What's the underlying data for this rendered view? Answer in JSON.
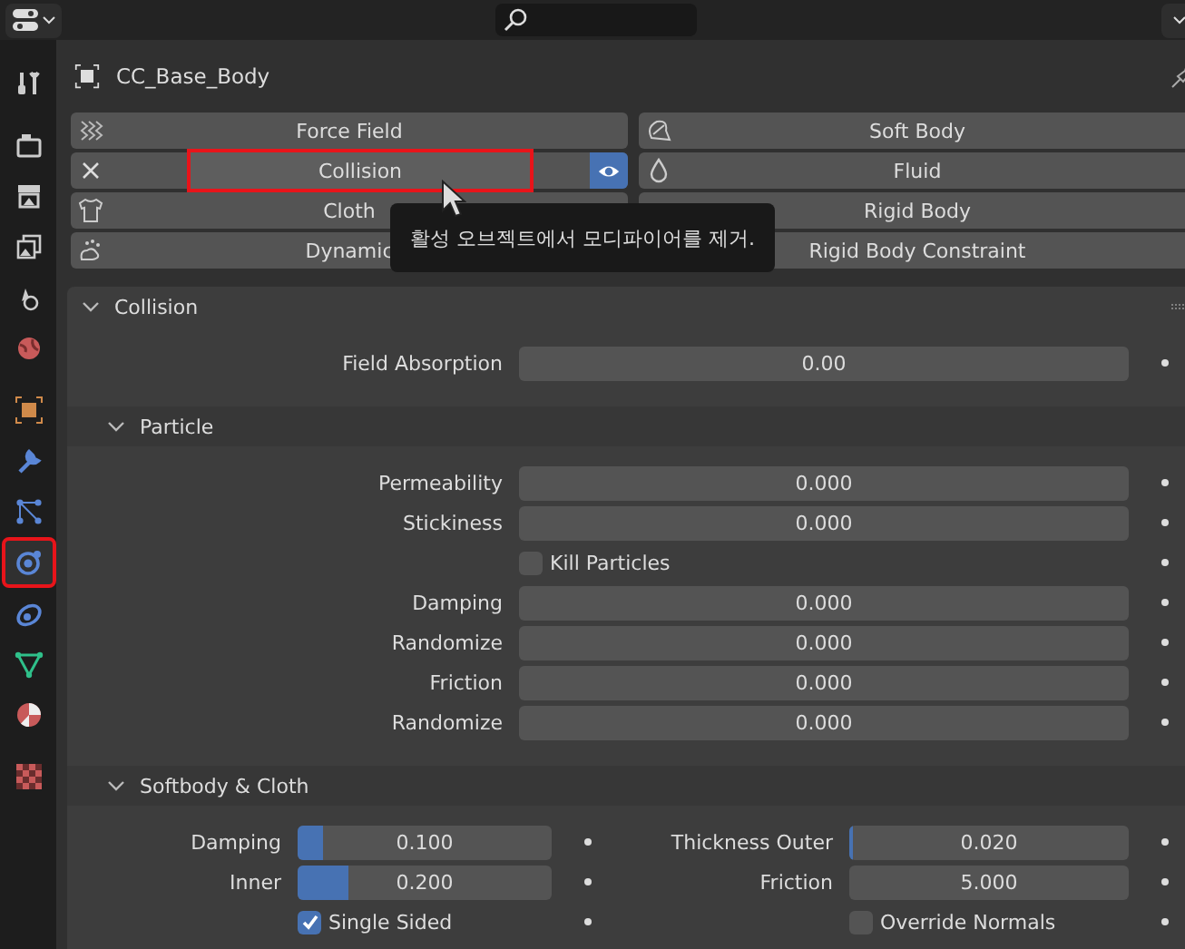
{
  "sidebar": [
    [
      {
        "kind": "tool",
        "selected": false,
        "highlighted": false
      }
    ],
    [
      {
        "kind": "render",
        "selected": false,
        "highlighted": false
      },
      {
        "kind": "output",
        "selected": false,
        "highlighted": false
      },
      {
        "kind": "view_layer",
        "selected": false,
        "highlighted": false
      },
      {
        "kind": "scene",
        "selected": false,
        "highlighted": false
      },
      {
        "kind": "world",
        "selected": false,
        "highlighted": false
      }
    ],
    [
      {
        "kind": "object",
        "selected": false,
        "highlighted": false
      },
      {
        "kind": "modifiers",
        "selected": false,
        "highlighted": false
      },
      {
        "kind": "particles",
        "selected": false,
        "highlighted": false
      },
      {
        "kind": "physics",
        "selected": true,
        "highlighted": true
      },
      {
        "kind": "constraints",
        "selected": false,
        "highlighted": false
      },
      {
        "kind": "data",
        "selected": false,
        "highlighted": false
      },
      {
        "kind": "material",
        "selected": false,
        "highlighted": false
      }
    ],
    [
      {
        "kind": "texture",
        "selected": false,
        "highlighted": false
      }
    ]
  ],
  "header": {
    "object_name": "CC_Base_Body"
  },
  "physics_buttons": [
    [
      {
        "label": "Force Field",
        "kind": "forcefield",
        "enabled": false,
        "highlighted": false
      },
      {
        "label": "Collision",
        "kind": "collision",
        "enabled": true,
        "highlighted": true
      },
      {
        "label": "Cloth",
        "kind": "cloth",
        "enabled": false,
        "highlighted": false
      },
      {
        "label": "Dynamic",
        "kind": "paint",
        "enabled": false,
        "highlighted": false
      }
    ],
    [
      {
        "label": "Soft Body",
        "kind": "softbody",
        "enabled": false,
        "highlighted": false
      },
      {
        "label": "Fluid",
        "kind": "fluid",
        "enabled": false,
        "highlighted": false
      },
      {
        "label": "Rigid Body",
        "kind": "none",
        "enabled": false,
        "highlighted": false
      },
      {
        "label": "Rigid Body Constraint",
        "kind": "none",
        "enabled": false,
        "highlighted": false
      }
    ]
  ],
  "tooltip": {
    "text": "활성 오브젝트에서 모디파이어를 제거."
  },
  "collision_panel": {
    "title": "Collision",
    "expanded": true,
    "rows": [
      {
        "kind": "number",
        "label": "Field Absorption",
        "value": "0.00"
      }
    ],
    "subpanel": {
      "title": "Particle",
      "expanded": true,
      "rows": [
        {
          "kind": "number",
          "label": "Permeability",
          "value": "0.000"
        },
        {
          "kind": "number",
          "label": "Stickiness",
          "value": "0.000"
        },
        {
          "kind": "checkbox",
          "label": "Kill Particles",
          "checked": false
        },
        {
          "kind": "number",
          "label": "Damping",
          "value": "0.000"
        },
        {
          "kind": "number",
          "label": "Randomize",
          "value": "0.000"
        },
        {
          "kind": "number",
          "label": "Friction",
          "value": "0.000"
        },
        {
          "kind": "number",
          "label": "Randomize",
          "value": "0.000"
        }
      ]
    }
  },
  "softbody_panel": {
    "title": "Softbody & Cloth",
    "expanded": true,
    "columns": [
      [
        {
          "kind": "slider",
          "label": "Damping",
          "value": "0.100",
          "level": 0.1
        },
        {
          "kind": "slider",
          "label": "Inner",
          "value": "0.200",
          "level": 0.2
        },
        {
          "kind": "checkbox",
          "label": "Single Sided",
          "checked": true
        }
      ],
      [
        {
          "kind": "slider",
          "label": "Thickness Outer",
          "value": "0.020",
          "level": 0.01
        },
        {
          "kind": "number",
          "label": "Friction",
          "value": "5.000"
        },
        {
          "kind": "checkbox",
          "label": "Override Normals",
          "checked": false
        }
      ]
    ]
  }
}
